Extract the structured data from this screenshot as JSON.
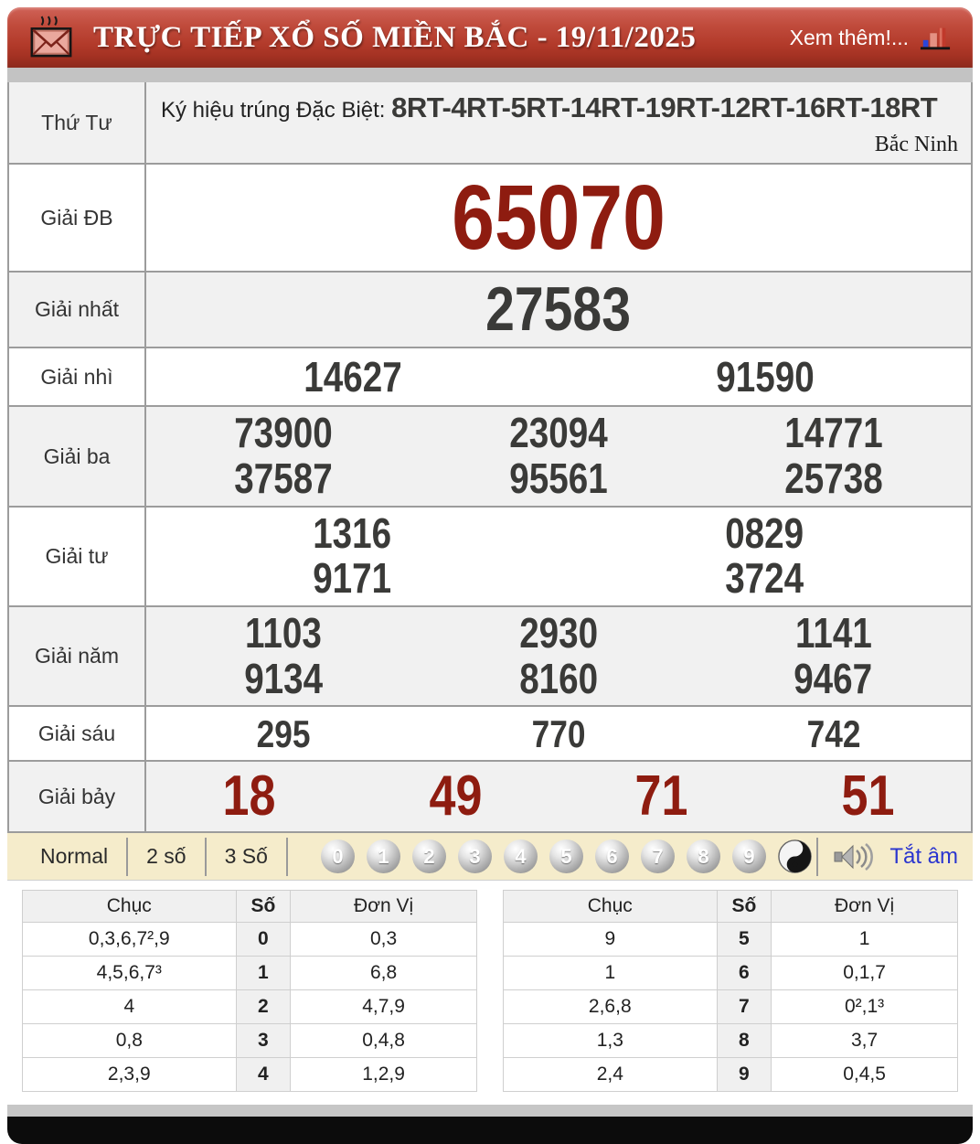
{
  "header": {
    "title": "TRỰC TIẾP XỔ SỐ MIỀN BẮC - 19/11/2025",
    "more": "Xem thêm!..."
  },
  "info": {
    "day": "Thứ Tư",
    "symbol_label": "Ký hiệu trúng Đặc Biệt: ",
    "symbols": "8RT-4RT-5RT-14RT-19RT-12RT-16RT-18RT",
    "province": "Bắc Ninh"
  },
  "prizes": {
    "db": {
      "label": "Giải ĐB",
      "numbers": [
        "65070"
      ]
    },
    "nhat": {
      "label": "Giải nhất",
      "numbers": [
        "27583"
      ]
    },
    "nhi": {
      "label": "Giải nhì",
      "numbers": [
        "14627",
        "91590"
      ]
    },
    "ba": {
      "label": "Giải ba",
      "numbers": [
        "73900",
        "23094",
        "14771",
        "37587",
        "95561",
        "25738"
      ]
    },
    "tu": {
      "label": "Giải tư",
      "numbers": [
        "1316",
        "0829",
        "9171",
        "3724"
      ]
    },
    "nam": {
      "label": "Giải năm",
      "numbers": [
        "1103",
        "2930",
        "1141",
        "9134",
        "8160",
        "9467"
      ]
    },
    "sau": {
      "label": "Giải sáu",
      "numbers": [
        "295",
        "770",
        "742"
      ]
    },
    "bay": {
      "label": "Giải bảy",
      "numbers": [
        "18",
        "49",
        "71",
        "51"
      ]
    }
  },
  "toolbar": {
    "modes": [
      "Normal",
      "2 số",
      "3 Số"
    ],
    "balls": [
      "0",
      "1",
      "2",
      "3",
      "4",
      "5",
      "6",
      "7",
      "8",
      "9"
    ],
    "yinyang_icon": "yin-yang-ball",
    "speaker_icon": "speaker-icon",
    "mute": "Tắt âm"
  },
  "stats": {
    "headers": [
      "Chục",
      "Số",
      "Đơn Vị"
    ],
    "left": [
      [
        "0,3,6,7²,9",
        "0",
        "0,3"
      ],
      [
        "4,5,6,7³",
        "1",
        "6,8"
      ],
      [
        "4",
        "2",
        "4,7,9"
      ],
      [
        "0,8",
        "3",
        "0,4,8"
      ],
      [
        "2,3,9",
        "4",
        "1,2,9"
      ]
    ],
    "right": [
      [
        "9",
        "5",
        "1"
      ],
      [
        "1",
        "6",
        "0,1,7"
      ],
      [
        "2,6,8",
        "7",
        "0²,1³"
      ],
      [
        "1,3",
        "8",
        "3,7"
      ],
      [
        "2,4",
        "9",
        "0,4,5"
      ]
    ]
  },
  "colors": {
    "accent_red": "#8e1c10",
    "header_red": "#b23a2a",
    "toolbar_cream": "#f5eccb",
    "link_blue": "#2a35cf",
    "number_dark": "#3a3a38"
  }
}
